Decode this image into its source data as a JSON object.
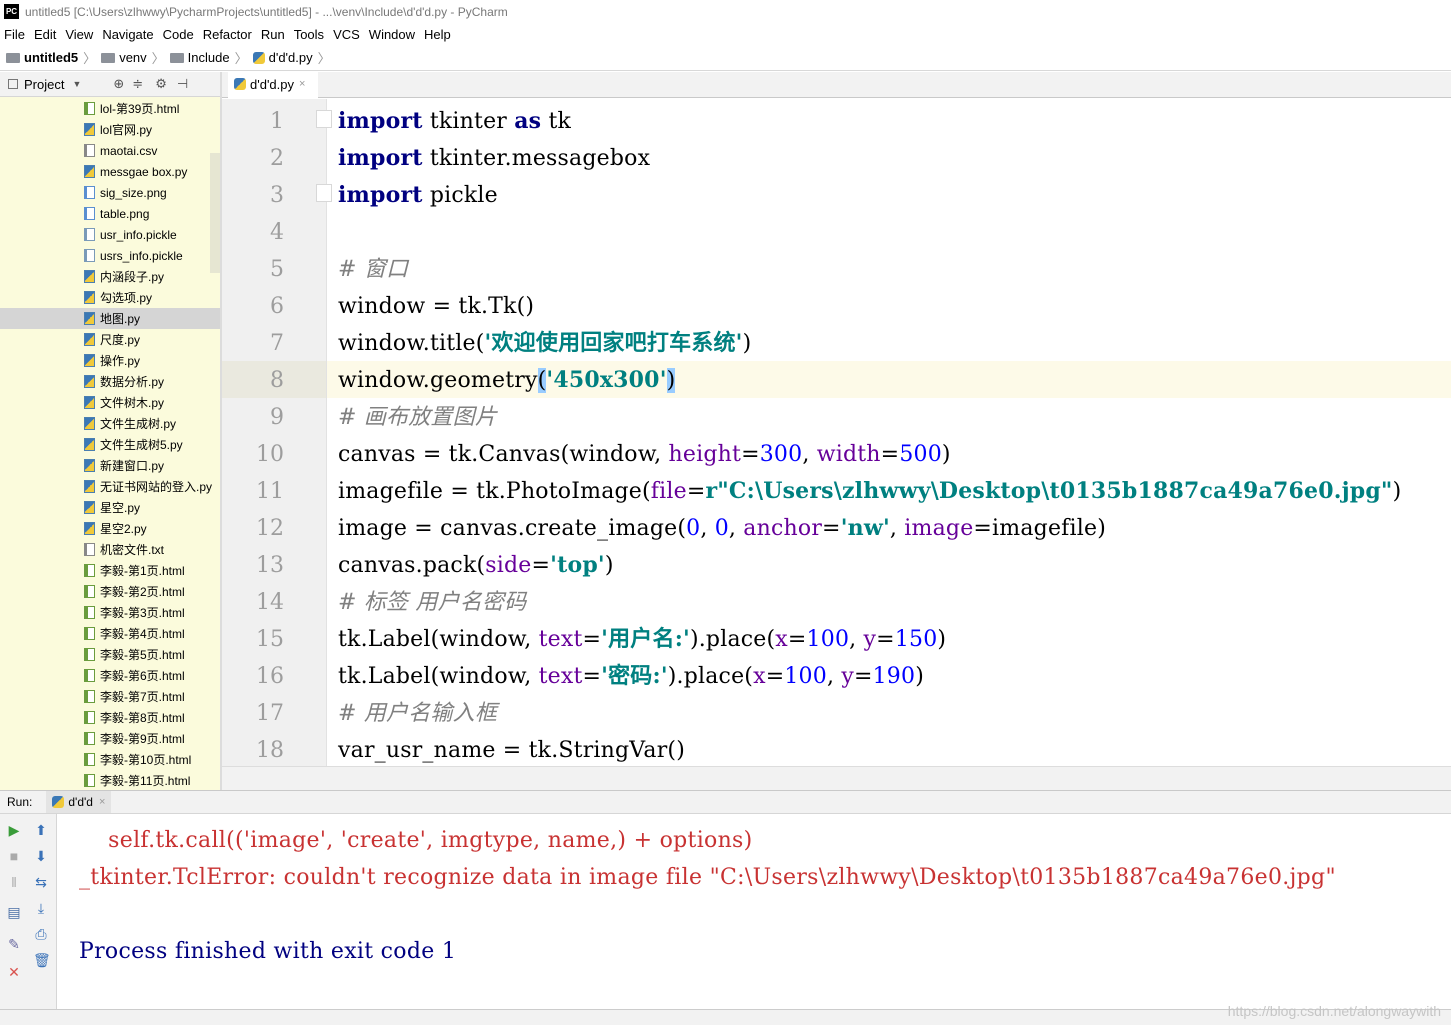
{
  "window": {
    "title": "untitled5 [C:\\Users\\zlhwwy\\PycharmProjects\\untitled5] - ...\\venv\\Include\\d'd'd.py - PyCharm",
    "app_badge": "PC"
  },
  "menu": [
    "File",
    "Edit",
    "View",
    "Navigate",
    "Code",
    "Refactor",
    "Run",
    "Tools",
    "VCS",
    "Window",
    "Help"
  ],
  "breadcrumb": [
    "untitled5",
    "venv",
    "Include",
    "d'd'd.py"
  ],
  "project_panel": {
    "label": "Project"
  },
  "files": [
    {
      "name": "lol-第39页.html",
      "type": "html"
    },
    {
      "name": "lol官网.py",
      "type": "py"
    },
    {
      "name": "maotai.csv",
      "type": "csv"
    },
    {
      "name": "messgae box.py",
      "type": "py"
    },
    {
      "name": "sig_size.png",
      "type": "png"
    },
    {
      "name": "table.png",
      "type": "png"
    },
    {
      "name": "usr_info.pickle",
      "type": "pickle"
    },
    {
      "name": "usrs_info.pickle",
      "type": "pickle"
    },
    {
      "name": "内涵段子.py",
      "type": "py"
    },
    {
      "name": "勾选项.py",
      "type": "py"
    },
    {
      "name": "地图.py",
      "type": "py",
      "selected": true
    },
    {
      "name": "尺度.py",
      "type": "py"
    },
    {
      "name": "操作.py",
      "type": "py"
    },
    {
      "name": "数据分析.py",
      "type": "py"
    },
    {
      "name": "文件树木.py",
      "type": "py"
    },
    {
      "name": "文件生成树.py",
      "type": "py"
    },
    {
      "name": "文件生成树5.py",
      "type": "py"
    },
    {
      "name": "新建窗口.py",
      "type": "py"
    },
    {
      "name": "无证书网站的登入.py",
      "type": "py"
    },
    {
      "name": "星空.py",
      "type": "py"
    },
    {
      "name": "星空2.py",
      "type": "py"
    },
    {
      "name": "机密文件.txt",
      "type": "txt"
    },
    {
      "name": "李毅-第1页.html",
      "type": "html"
    },
    {
      "name": "李毅-第2页.html",
      "type": "html"
    },
    {
      "name": "李毅-第3页.html",
      "type": "html"
    },
    {
      "name": "李毅-第4页.html",
      "type": "html"
    },
    {
      "name": "李毅-第5页.html",
      "type": "html"
    },
    {
      "name": "李毅-第6页.html",
      "type": "html"
    },
    {
      "name": "李毅-第7页.html",
      "type": "html"
    },
    {
      "name": "李毅-第8页.html",
      "type": "html"
    },
    {
      "name": "李毅-第9页.html",
      "type": "html"
    },
    {
      "name": "李毅-第10页.html",
      "type": "html"
    },
    {
      "name": "李毅-第11页.html",
      "type": "html"
    }
  ],
  "editor_tab": {
    "label": "d'd'd.py",
    "close": "×"
  },
  "line_numbers": [
    "1",
    "2",
    "3",
    "4",
    "5",
    "6",
    "7",
    "8",
    "9",
    "10",
    "11",
    "12",
    "13",
    "14",
    "15",
    "16",
    "17",
    "18"
  ],
  "code": {
    "l1": {
      "kw1": "import",
      "t1": " tkinter ",
      "kw2": "as",
      "t2": " tk"
    },
    "l2": {
      "kw1": "import",
      "t1": " tkinter.messagebox"
    },
    "l3": {
      "kw1": "import",
      "t1": " pickle"
    },
    "l5": {
      "cm": "# 窗口"
    },
    "l6": {
      "t1": "window = tk.Tk()"
    },
    "l7": {
      "t1": "window.title(",
      "s1": "'欢迎使用回家吧打车系统'",
      "t2": ")"
    },
    "l8": {
      "t1": "window.geometry",
      "b1": "(",
      "s1": "'450x300'",
      "b2": ")"
    },
    "l9": {
      "cm": "# 画布放置图片"
    },
    "l10": {
      "t1": "canvas = tk.Canvas(window, ",
      "p1": "height",
      "t2": "=",
      "n1": "300",
      "t3": ", ",
      "p2": "width",
      "t4": "=",
      "n2": "500",
      "t5": ")"
    },
    "l11": {
      "t1": "imagefile = tk.PhotoImage(",
      "p1": "file",
      "t2": "=",
      "s1": "r\"C:\\Users\\zlhwwy\\Desktop\\t0135b1887ca49a76e0.jpg\"",
      "t3": ")"
    },
    "l12": {
      "t1": "image = canvas.create_image(",
      "n1": "0",
      "t2": ", ",
      "n2": "0",
      "t3": ", ",
      "p1": "anchor",
      "t4": "=",
      "s1": "'nw'",
      "t5": ", ",
      "p2": "image",
      "t6": "=imagefile)"
    },
    "l13": {
      "t1": "canvas.pack(",
      "p1": "side",
      "t2": "=",
      "s1": "'top'",
      "t3": ")"
    },
    "l14": {
      "cm": "# 标签 用户名密码"
    },
    "l15": {
      "t1": "tk.Label(window, ",
      "p1": "text",
      "t2": "=",
      "s1": "'用户名:'",
      "t3": ").place(",
      "p2": "x",
      "t4": "=",
      "n1": "100",
      "t5": ", ",
      "p3": "y",
      "t6": "=",
      "n2": "150",
      "t7": ")"
    },
    "l16": {
      "t1": "tk.Label(window, ",
      "p1": "text",
      "t2": "=",
      "s1": "'密码:'",
      "t3": ").place(",
      "p2": "x",
      "t4": "=",
      "n1": "100",
      "t5": ", ",
      "p3": "y",
      "t6": "=",
      "n2": "190",
      "t7": ")"
    },
    "l17": {
      "cm": "# 用户名输入框"
    },
    "l18": {
      "t1": "var_usr_name = tk.StringVar()"
    }
  },
  "run_panel": {
    "label": "Run:",
    "tab": "d'd'd",
    "close": "×"
  },
  "console": {
    "line1": "    self.tk.call(('image', 'create', imgtype, name,) + options)",
    "line2": "_tkinter.TclError: couldn't recognize data in image file \"C:\\Users\\zlhwwy\\Desktop\\t0135b1887ca49a76e0.jpg\"",
    "line3": "Process finished with exit code 1"
  },
  "watermark": "https://blog.csdn.net/alongwaywith",
  "colors": {
    "sidebar_bg": "#fbfbdc",
    "keyword": "#000080",
    "string": "#008080",
    "comment": "#808080",
    "param": "#660099",
    "number": "#0000ff",
    "error": "#c83232"
  }
}
